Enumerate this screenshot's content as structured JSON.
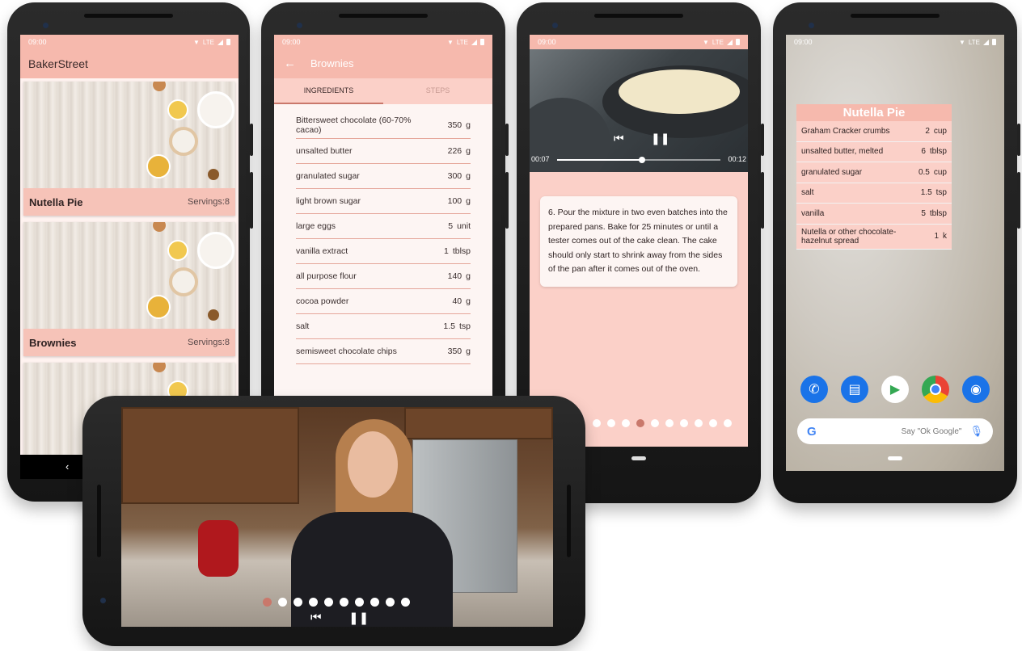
{
  "status": {
    "time": "09:00",
    "network": "LTE"
  },
  "phone1": {
    "app_title": "BakerStreet",
    "recipes": [
      {
        "name": "Nutella Pie",
        "servings": "Servings:8"
      },
      {
        "name": "Brownies",
        "servings": "Servings:8"
      }
    ]
  },
  "phone2": {
    "title": "Brownies",
    "tabs": [
      {
        "label": "INGREDIENTS"
      },
      {
        "label": "STEPS"
      }
    ],
    "ingredients": [
      {
        "name": "Bittersweet chocolate (60-70% cacao)",
        "qty": "350",
        "unit": "g"
      },
      {
        "name": "unsalted butter",
        "qty": "226",
        "unit": "g"
      },
      {
        "name": "granulated sugar",
        "qty": "300",
        "unit": "g"
      },
      {
        "name": "light brown sugar",
        "qty": "100",
        "unit": "g"
      },
      {
        "name": "large eggs",
        "qty": "5",
        "unit": "unit"
      },
      {
        "name": "vanilla extract",
        "qty": "1",
        "unit": "tblsp"
      },
      {
        "name": "all purpose flour",
        "qty": "140",
        "unit": "g"
      },
      {
        "name": "cocoa powder",
        "qty": "40",
        "unit": "g"
      },
      {
        "name": "salt",
        "qty": "1.5",
        "unit": "tsp"
      },
      {
        "name": "semisweet chocolate chips",
        "qty": "350",
        "unit": "g"
      }
    ]
  },
  "phone3": {
    "time_elapsed": "00:07",
    "time_total": "00:12",
    "progress": 0.52,
    "step_text": "6. Pour the mixture in two even batches into the prepared pans. Bake for 25 minutes or until a tester comes out of the cake clean. The cake should only start to shrink away from the sides of the pan after it comes out of the oven.",
    "step_count": 10,
    "active_step": 3
  },
  "phone4": {
    "widget_title": "Nutella Pie",
    "ingredients": [
      {
        "name": "Graham Cracker crumbs",
        "qty": "2",
        "unit": "cup"
      },
      {
        "name": "unsalted butter, melted",
        "qty": "6",
        "unit": "tblsp"
      },
      {
        "name": "granulated sugar",
        "qty": "0.5",
        "unit": "cup"
      },
      {
        "name": "salt",
        "qty": "1.5",
        "unit": "tsp"
      },
      {
        "name": "vanilla",
        "qty": "5",
        "unit": "tblsp"
      },
      {
        "name": "Nutella or other chocolate-hazelnut spread",
        "qty": "1",
        "unit": "k"
      }
    ],
    "dock_apps": [
      {
        "icon": "phone-icon",
        "color": "#1a73e8"
      },
      {
        "icon": "messages-icon",
        "color": "#1a73e8"
      },
      {
        "icon": "play-store-icon",
        "color": "#ffffff"
      },
      {
        "icon": "chrome-icon",
        "color": "#ffffff"
      },
      {
        "icon": "camera-icon",
        "color": "#1a73e8"
      }
    ],
    "search_placeholder": "Say \"Ok Google\""
  },
  "phone5": {
    "step_count": 10,
    "active_step": 0
  },
  "colors": {
    "primary": "#f6b9ad",
    "primary_light": "#fbd0c8",
    "accent": "#c9786b"
  }
}
